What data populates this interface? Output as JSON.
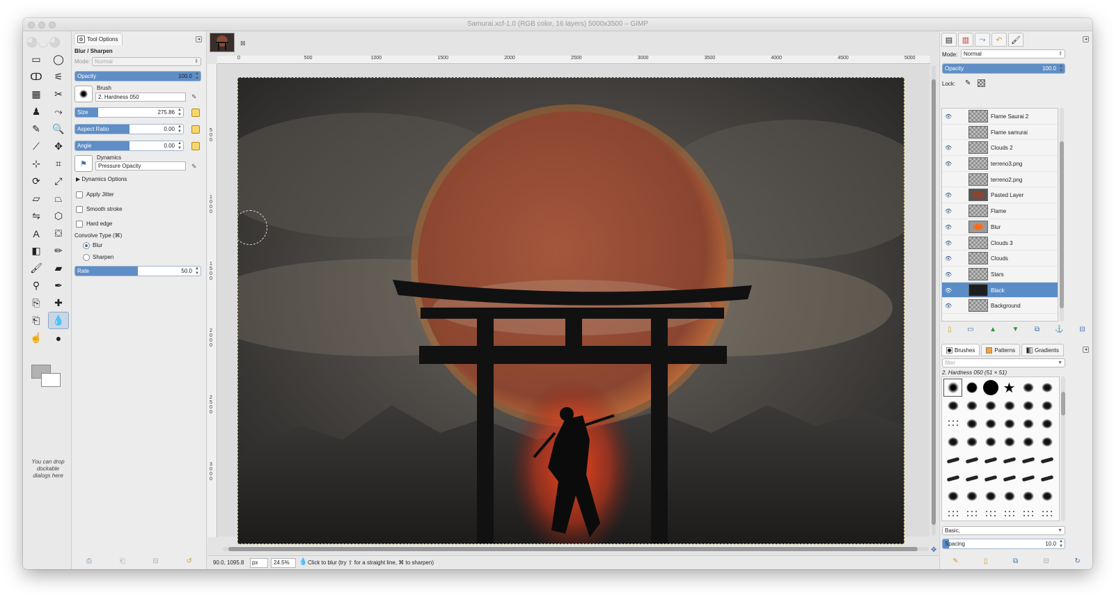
{
  "window": {
    "title": "Samurai.xcf-1.0 (RGB color, 16 layers) 5000x3500 – GIMP"
  },
  "toolbox": {
    "drop_hint": "You can drop dockable dialogs here",
    "tools": [
      {
        "name": "rect-select-icon",
        "glyph": "▭"
      },
      {
        "name": "ellipse-select-icon",
        "glyph": "◯"
      },
      {
        "name": "free-select-icon",
        "glyph": "ↀ"
      },
      {
        "name": "fuzzy-select-icon",
        "glyph": "⚟"
      },
      {
        "name": "select-by-color-icon",
        "glyph": "▦"
      },
      {
        "name": "scissors-select-icon",
        "glyph": "✂"
      },
      {
        "name": "foreground-select-icon",
        "glyph": "♟"
      },
      {
        "name": "paths-icon",
        "glyph": "⤳"
      },
      {
        "name": "color-picker-icon",
        "glyph": "✎"
      },
      {
        "name": "zoom-icon",
        "glyph": "🔍"
      },
      {
        "name": "measure-icon",
        "glyph": "⟋"
      },
      {
        "name": "move-icon",
        "glyph": "✥"
      },
      {
        "name": "align-icon",
        "glyph": "⊹"
      },
      {
        "name": "crop-icon",
        "glyph": "⌗"
      },
      {
        "name": "rotate-icon",
        "glyph": "⟳"
      },
      {
        "name": "scale-icon",
        "glyph": "⤢"
      },
      {
        "name": "shear-icon",
        "glyph": "▱"
      },
      {
        "name": "perspective-icon",
        "glyph": "⏢"
      },
      {
        "name": "flip-icon",
        "glyph": "⇋"
      },
      {
        "name": "cage-transform-icon",
        "glyph": "⬡"
      },
      {
        "name": "text-icon",
        "glyph": "A"
      },
      {
        "name": "bucket-fill-icon",
        "glyph": "⛋"
      },
      {
        "name": "blend-icon",
        "glyph": "◧"
      },
      {
        "name": "pencil-icon",
        "glyph": "✏"
      },
      {
        "name": "paintbrush-icon",
        "glyph": "🖌"
      },
      {
        "name": "eraser-icon",
        "glyph": "▰"
      },
      {
        "name": "airbrush-icon",
        "glyph": "⚲"
      },
      {
        "name": "ink-icon",
        "glyph": "✒"
      },
      {
        "name": "clone-icon",
        "glyph": "⎘"
      },
      {
        "name": "heal-icon",
        "glyph": "✚"
      },
      {
        "name": "perspective-clone-icon",
        "glyph": "⎗"
      },
      {
        "name": "blur-sharpen-icon",
        "glyph": "💧"
      },
      {
        "name": "smudge-icon",
        "glyph": "☝"
      },
      {
        "name": "dodge-burn-icon",
        "glyph": "●"
      }
    ]
  },
  "tool_options": {
    "tab_label": "Tool Options",
    "heading": "Blur / Sharpen",
    "mode_label": "Mode:",
    "mode_value": "Normal",
    "opacity": {
      "label": "Opacity",
      "value": "100.0",
      "fraction": 1.0
    },
    "brush_label": "Brush",
    "brush_value": "2. Hardness 050",
    "size": {
      "label": "Size",
      "value": "275.86",
      "fraction": 0.21
    },
    "aspect_ratio": {
      "label": "Aspect Ratio",
      "value": "0.00",
      "fraction": 0.5
    },
    "angle": {
      "label": "Angle",
      "value": "0.00",
      "fraction": 0.5
    },
    "dynamics_label": "Dynamics",
    "dynamics_value": "Pressure Opacity",
    "dynamics_options": "Dynamics Options",
    "apply_jitter": "Apply Jitter",
    "smooth_stroke": "Smooth stroke",
    "hard_edge": "Hard edge",
    "convolve_type": "Convolve Type  (⌘)",
    "radio_blur": "Blur",
    "radio_sharpen": "Sharpen",
    "rate": {
      "label": "Rate",
      "value": "50.0",
      "fraction": 0.5
    }
  },
  "canvas": {
    "ruler_labels": [
      "0",
      "500",
      "1000",
      "1500",
      "2000",
      "2500",
      "3000",
      "3500",
      "4000",
      "4500",
      "5000"
    ],
    "vruler_labels": [
      "500",
      "1000",
      "1500",
      "2000",
      "2500",
      "3000"
    ],
    "status_coords": "90.0, 1095.8",
    "status_unit": "px",
    "status_zoom": "24.5%",
    "status_message": "Click to blur (try ⇧ for a straight line, ⌘ to sharpen)"
  },
  "layers": {
    "mode_label": "Mode:",
    "mode_value": "Normal",
    "opacity_label": "Opacity",
    "opacity_value": "100.0",
    "lock_label": "Lock:",
    "items": [
      {
        "name": "Flame Saurai 2",
        "visible": true,
        "selected": false,
        "thumb": "checker"
      },
      {
        "name": "Flame samurai",
        "visible": false,
        "selected": false,
        "thumb": "checker"
      },
      {
        "name": "Clouds 2",
        "visible": true,
        "selected": false,
        "thumb": "checker"
      },
      {
        "name": "terreno3.png",
        "visible": true,
        "selected": false,
        "thumb": "checker"
      },
      {
        "name": "terreno2.png",
        "visible": false,
        "selected": false,
        "thumb": "checker"
      },
      {
        "name": "Pasted Layer",
        "visible": true,
        "selected": false,
        "thumb": "moon"
      },
      {
        "name": "Flame",
        "visible": true,
        "selected": false,
        "thumb": "checker"
      },
      {
        "name": "Blur",
        "visible": true,
        "selected": false,
        "thumb": "orange"
      },
      {
        "name": "Clouds 3",
        "visible": true,
        "selected": false,
        "thumb": "checker"
      },
      {
        "name": "Clouds",
        "visible": true,
        "selected": false,
        "thumb": "checker"
      },
      {
        "name": "Stars",
        "visible": true,
        "selected": false,
        "thumb": "checker"
      },
      {
        "name": "Black",
        "visible": true,
        "selected": true,
        "thumb": "dark"
      },
      {
        "name": "Background",
        "visible": true,
        "selected": false,
        "thumb": "checker"
      }
    ]
  },
  "brushes": {
    "tabs": [
      "Brushes",
      "Patterns",
      "Gradients"
    ],
    "filter_placeholder": "filter",
    "current": "2. Hardness 050 (51 × 51)",
    "category": "Basic,",
    "spacing_label": "Spacing",
    "spacing_value": "10.0"
  }
}
